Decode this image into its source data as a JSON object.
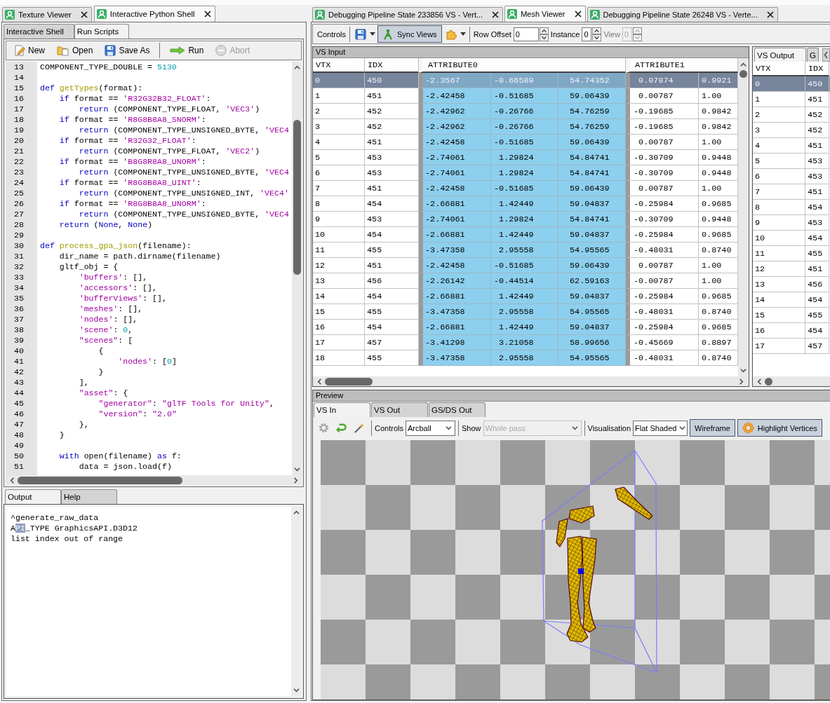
{
  "left_panel": {
    "tabs": [
      {
        "label": "Texture Viewer",
        "selected": false
      },
      {
        "label": "Interactive Python Shell",
        "selected": true
      }
    ],
    "script_tabs": [
      {
        "label": "Interactive Shell",
        "selected": false
      },
      {
        "label": "Run Scripts",
        "selected": true
      }
    ],
    "toolbar": [
      {
        "kind": "new",
        "label": "New",
        "disabled": false
      },
      {
        "kind": "open",
        "label": "Open",
        "disabled": false
      },
      {
        "kind": "save_as",
        "label": "Save As",
        "disabled": false
      },
      {
        "kind": "separator"
      },
      {
        "kind": "run",
        "label": "Run",
        "disabled": false
      },
      {
        "kind": "abort",
        "label": "Abort",
        "disabled": true
      }
    ],
    "editor": {
      "lines": [
        {
          "number": "13",
          "tokens": [
            {
              "kind": "plain",
              "text": "COMPONENT_TYPE_DOUBLE = "
            },
            {
              "kind": "number",
              "text": "5130"
            }
          ]
        },
        {
          "number": "14"
        },
        {
          "number": "15",
          "tokens": [
            {
              "kind": "keyword",
              "text": "def "
            },
            {
              "kind": "function",
              "text": "getTypes"
            },
            {
              "kind": "plain",
              "text": "(format):"
            }
          ]
        },
        {
          "number": "16",
          "tokens": [
            {
              "kind": "keyword",
              "text": "    if"
            },
            {
              "kind": "plain",
              "text": " format == "
            },
            {
              "kind": "string",
              "text": "'R32G32B32_FLOAT'"
            },
            {
              "kind": "plain",
              "text": ":"
            }
          ]
        },
        {
          "number": "17",
          "tokens": [
            {
              "kind": "keyword",
              "text": "        return"
            },
            {
              "kind": "plain",
              "text": " (COMPONENT_TYPE_FLOAT, "
            },
            {
              "kind": "string",
              "text": "'VEC3'"
            },
            {
              "kind": "plain",
              "text": ")"
            }
          ]
        },
        {
          "number": "18",
          "tokens": [
            {
              "kind": "keyword",
              "text": "    if"
            },
            {
              "kind": "plain",
              "text": " format == "
            },
            {
              "kind": "string",
              "text": "'R8G8B8A8_SNORM'"
            },
            {
              "kind": "plain",
              "text": ":"
            }
          ]
        },
        {
          "number": "19",
          "tokens": [
            {
              "kind": "keyword",
              "text": "        return"
            },
            {
              "kind": "plain",
              "text": " (COMPONENT_TYPE_UNSIGNED_BYTE, "
            },
            {
              "kind": "string",
              "text": "'VEC4"
            }
          ]
        },
        {
          "number": "20",
          "tokens": [
            {
              "kind": "keyword",
              "text": "    if"
            },
            {
              "kind": "plain",
              "text": " format == "
            },
            {
              "kind": "string",
              "text": "'R32G32_FLOAT'"
            },
            {
              "kind": "plain",
              "text": ":"
            }
          ]
        },
        {
          "number": "21",
          "tokens": [
            {
              "kind": "keyword",
              "text": "        return"
            },
            {
              "kind": "plain",
              "text": " (COMPONENT_TYPE_FLOAT, "
            },
            {
              "kind": "string",
              "text": "'VEC2'"
            },
            {
              "kind": "plain",
              "text": ")"
            }
          ]
        },
        {
          "number": "22",
          "tokens": [
            {
              "kind": "keyword",
              "text": "    if"
            },
            {
              "kind": "plain",
              "text": " format == "
            },
            {
              "kind": "string",
              "text": "'B8G8R8A8_UNORM'"
            },
            {
              "kind": "plain",
              "text": ":"
            }
          ]
        },
        {
          "number": "23",
          "tokens": [
            {
              "kind": "keyword",
              "text": "        return"
            },
            {
              "kind": "plain",
              "text": " (COMPONENT_TYPE_UNSIGNED_BYTE, "
            },
            {
              "kind": "string",
              "text": "'VEC4"
            }
          ]
        },
        {
          "number": "24",
          "tokens": [
            {
              "kind": "keyword",
              "text": "    if"
            },
            {
              "kind": "plain",
              "text": " format == "
            },
            {
              "kind": "string",
              "text": "'R8G8B8A8_UINT'"
            },
            {
              "kind": "plain",
              "text": ":"
            }
          ]
        },
        {
          "number": "25",
          "tokens": [
            {
              "kind": "keyword",
              "text": "        return"
            },
            {
              "kind": "plain",
              "text": " (COMPONENT_TYPE_UNSIGNED_INT, "
            },
            {
              "kind": "string",
              "text": "'VEC4'"
            }
          ]
        },
        {
          "number": "26",
          "tokens": [
            {
              "kind": "keyword",
              "text": "    if"
            },
            {
              "kind": "plain",
              "text": " format == "
            },
            {
              "kind": "string",
              "text": "'R8G8B8A8_UNORM'"
            },
            {
              "kind": "plain",
              "text": ":"
            }
          ]
        },
        {
          "number": "27",
          "tokens": [
            {
              "kind": "keyword",
              "text": "        return"
            },
            {
              "kind": "plain",
              "text": " (COMPONENT_TYPE_UNSIGNED_BYTE, "
            },
            {
              "kind": "string",
              "text": "'VEC4"
            }
          ]
        },
        {
          "number": "28",
          "tokens": [
            {
              "kind": "keyword",
              "text": "    return"
            },
            {
              "kind": "plain",
              "text": " ("
            },
            {
              "kind": "keyword",
              "text": "None"
            },
            {
              "kind": "plain",
              "text": ", "
            },
            {
              "kind": "keyword",
              "text": "None"
            },
            {
              "kind": "plain",
              "text": ")"
            }
          ]
        },
        {
          "number": "29"
        },
        {
          "number": "30",
          "tokens": [
            {
              "kind": "keyword",
              "text": "def "
            },
            {
              "kind": "function",
              "text": "process_gpa_json"
            },
            {
              "kind": "plain",
              "text": "(filename):"
            }
          ]
        },
        {
          "number": "31",
          "tokens": [
            {
              "kind": "plain",
              "text": "    dir_name = path.dirname(filename)"
            }
          ]
        },
        {
          "number": "32",
          "tokens": [
            {
              "kind": "plain",
              "text": "    gltf_obj = {"
            }
          ]
        },
        {
          "number": "33",
          "tokens": [
            {
              "kind": "string",
              "text": "        'buffers'"
            },
            {
              "kind": "plain",
              "text": ": [],"
            }
          ]
        },
        {
          "number": "34",
          "tokens": [
            {
              "kind": "string",
              "text": "        'accessors'"
            },
            {
              "kind": "plain",
              "text": ": [],"
            }
          ]
        },
        {
          "number": "35",
          "tokens": [
            {
              "kind": "string",
              "text": "        'bufferViews'"
            },
            {
              "kind": "plain",
              "text": ": [],"
            }
          ]
        },
        {
          "number": "36",
          "tokens": [
            {
              "kind": "string",
              "text": "        'meshes'"
            },
            {
              "kind": "plain",
              "text": ": [],"
            }
          ]
        },
        {
          "number": "37",
          "tokens": [
            {
              "kind": "string",
              "text": "        'nodes'"
            },
            {
              "kind": "plain",
              "text": ": [],"
            }
          ]
        },
        {
          "number": "38",
          "tokens": [
            {
              "kind": "string",
              "text": "        'scene'"
            },
            {
              "kind": "plain",
              "text": ": "
            },
            {
              "kind": "number",
              "text": "0"
            },
            {
              "kind": "plain",
              "text": ","
            }
          ]
        },
        {
          "number": "39",
          "tokens": [
            {
              "kind": "string",
              "text": "        \"scenes\""
            },
            {
              "kind": "plain",
              "text": ": ["
            }
          ]
        },
        {
          "number": "40",
          "tokens": [
            {
              "kind": "plain",
              "text": "            {"
            }
          ]
        },
        {
          "number": "41",
          "tokens": [
            {
              "kind": "string",
              "text": "                'nodes'"
            },
            {
              "kind": "plain",
              "text": ": ["
            },
            {
              "kind": "number",
              "text": "0"
            },
            {
              "kind": "plain",
              "text": "]"
            }
          ]
        },
        {
          "number": "42",
          "tokens": [
            {
              "kind": "plain",
              "text": "            }"
            }
          ]
        },
        {
          "number": "43",
          "tokens": [
            {
              "kind": "plain",
              "text": "        ],"
            }
          ]
        },
        {
          "number": "44",
          "tokens": [
            {
              "kind": "string",
              "text": "        \"asset\""
            },
            {
              "kind": "plain",
              "text": ": {"
            }
          ]
        },
        {
          "number": "45",
          "tokens": [
            {
              "kind": "string",
              "text": "            \"generator\""
            },
            {
              "kind": "plain",
              "text": ": "
            },
            {
              "kind": "string",
              "text": "\"glTF Tools for Unity\""
            },
            {
              "kind": "plain",
              "text": ","
            }
          ]
        },
        {
          "number": "46",
          "tokens": [
            {
              "kind": "string",
              "text": "            \"version\""
            },
            {
              "kind": "plain",
              "text": ": "
            },
            {
              "kind": "string",
              "text": "\"2.0\""
            }
          ]
        },
        {
          "number": "47",
          "tokens": [
            {
              "kind": "plain",
              "text": "        },"
            }
          ]
        },
        {
          "number": "48",
          "tokens": [
            {
              "kind": "plain",
              "text": "    }"
            }
          ]
        },
        {
          "number": "49"
        },
        {
          "number": "50",
          "tokens": [
            {
              "kind": "keyword",
              "text": "    with"
            },
            {
              "kind": "plain",
              "text": " open(filename) "
            },
            {
              "kind": "keyword",
              "text": "as"
            },
            {
              "kind": "plain",
              "text": " f:"
            }
          ]
        },
        {
          "number": "51",
          "tokens": [
            {
              "kind": "plain",
              "text": "        data = json.load(f)"
            }
          ]
        }
      ]
    },
    "output_tabs": [
      {
        "label": "Output",
        "selected": true
      },
      {
        "label": "Help",
        "selected": false
      }
    ],
    "output": {
      "lines": [
        {
          "segments": [
            {
              "text": "^generate_raw_data",
              "selected": false
            }
          ]
        },
        {
          "segments": [
            {
              "text": "A",
              "selected": false
            },
            {
              "text": "PI",
              "selected": true
            },
            {
              "text": "_TYPE GraphicsAPI.D3D12",
              "selected": false
            }
          ]
        },
        {
          "segments": [
            {
              "text": "list index out of range",
              "selected": false
            }
          ]
        }
      ]
    }
  },
  "right_panel": {
    "tabs": [
      {
        "label": "Debugging Pipeline State 233856 VS - Vert...",
        "selected": false
      },
      {
        "label": "Mesh Viewer",
        "selected": true
      },
      {
        "label": "Debugging Pipeline State 26248 VS - Verte...",
        "selected": false
      }
    ],
    "toolbar": {
      "label": "Controls",
      "sync_views": {
        "label": "Sync Views",
        "on": true
      },
      "row_offset": {
        "label": "Row Offset",
        "value": "0",
        "disabled": false
      },
      "instance": {
        "label": "Instance",
        "value": "0",
        "disabled": false
      },
      "view": {
        "label": "View",
        "value": "0",
        "disabled": true
      }
    },
    "vs_input": {
      "title": "VS Input",
      "columns": [
        "VTX",
        "IDX",
        "ATTRIBUTE0",
        "ATTRIBUTE1"
      ],
      "rows": [
        {
          "selected": true,
          "cells": [
            "0",
            "450",
            [
              "-2.3567",
              "-0.66589",
              "54.74352"
            ],
            [
              "0.07874",
              "0.9921"
            ]
          ]
        },
        {
          "selected": false,
          "cells": [
            "1",
            "451",
            [
              "-2.42458",
              "-0.51685",
              "59.06439"
            ],
            [
              "0.00787",
              "1.00"
            ]
          ]
        },
        {
          "selected": false,
          "cells": [
            "2",
            "452",
            [
              "-2.42962",
              "-0.26766",
              "54.76259"
            ],
            [
              "-0.19685",
              "0.9842"
            ]
          ]
        },
        {
          "selected": false,
          "cells": [
            "3",
            "452",
            [
              "-2.42962",
              "-0.26766",
              "54.76259"
            ],
            [
              "-0.19685",
              "0.9842"
            ]
          ]
        },
        {
          "selected": false,
          "cells": [
            "4",
            "451",
            [
              "-2.42458",
              "-0.51685",
              "59.06439"
            ],
            [
              "0.00787",
              "1.00"
            ]
          ]
        },
        {
          "selected": false,
          "cells": [
            "5",
            "453",
            [
              "-2.74061",
              "1.29824",
              "54.84741"
            ],
            [
              "-0.30709",
              "0.9448"
            ]
          ]
        },
        {
          "selected": false,
          "cells": [
            "6",
            "453",
            [
              "-2.74061",
              "1.29824",
              "54.84741"
            ],
            [
              "-0.30709",
              "0.9448"
            ]
          ]
        },
        {
          "selected": false,
          "cells": [
            "7",
            "451",
            [
              "-2.42458",
              "-0.51685",
              "59.06439"
            ],
            [
              "0.00787",
              "1.00"
            ]
          ]
        },
        {
          "selected": false,
          "cells": [
            "8",
            "454",
            [
              "-2.66881",
              "1.42449",
              "59.04837"
            ],
            [
              "-0.25984",
              "0.9685"
            ]
          ]
        },
        {
          "selected": false,
          "cells": [
            "9",
            "453",
            [
              "-2.74061",
              "1.29824",
              "54.84741"
            ],
            [
              "-0.30709",
              "0.9448"
            ]
          ]
        },
        {
          "selected": false,
          "cells": [
            "10",
            "454",
            [
              "-2.66881",
              "1.42449",
              "59.04837"
            ],
            [
              "-0.25984",
              "0.9685"
            ]
          ]
        },
        {
          "selected": false,
          "cells": [
            "11",
            "455",
            [
              "-3.47358",
              "2.95558",
              "54.95565"
            ],
            [
              "-0.48031",
              "0.8740"
            ]
          ]
        },
        {
          "selected": false,
          "cells": [
            "12",
            "451",
            [
              "-2.42458",
              "-0.51685",
              "59.06439"
            ],
            [
              "0.00787",
              "1.00"
            ]
          ]
        },
        {
          "selected": false,
          "cells": [
            "13",
            "456",
            [
              "-2.26142",
              "-0.44514",
              "62.59163"
            ],
            [
              "-0.00787",
              "1.00"
            ]
          ]
        },
        {
          "selected": false,
          "cells": [
            "14",
            "454",
            [
              "-2.66881",
              "1.42449",
              "59.04837"
            ],
            [
              "-0.25984",
              "0.9685"
            ]
          ]
        },
        {
          "selected": false,
          "cells": [
            "15",
            "455",
            [
              "-3.47358",
              "2.95558",
              "54.95565"
            ],
            [
              "-0.48031",
              "0.8740"
            ]
          ]
        },
        {
          "selected": false,
          "cells": [
            "16",
            "454",
            [
              "-2.66881",
              "1.42449",
              "59.04837"
            ],
            [
              "-0.25984",
              "0.9685"
            ]
          ]
        },
        {
          "selected": false,
          "cells": [
            "17",
            "457",
            [
              "-3.41298",
              "3.21058",
              "58.99656"
            ],
            [
              "-0.45669",
              "0.8897"
            ]
          ]
        },
        {
          "selected": false,
          "cells": [
            "18",
            "455",
            [
              "-3.47358",
              "2.95558",
              "54.95565"
            ],
            [
              "-0.48031",
              "0.8740"
            ]
          ]
        }
      ]
    },
    "vs_output": {
      "tabs": [
        {
          "label": "VS Output",
          "selected": true
        },
        {
          "label": "G",
          "selected": false
        }
      ],
      "columns": [
        "VTX",
        "IDX"
      ],
      "rows": [
        {
          "selected": true,
          "cells": [
            "0",
            "450"
          ]
        },
        {
          "selected": false,
          "cells": [
            "1",
            "451"
          ]
        },
        {
          "selected": false,
          "cells": [
            "2",
            "452"
          ]
        },
        {
          "selected": false,
          "cells": [
            "3",
            "452"
          ]
        },
        {
          "selected": false,
          "cells": [
            "4",
            "451"
          ]
        },
        {
          "selected": false,
          "cells": [
            "5",
            "453"
          ]
        },
        {
          "selected": false,
          "cells": [
            "6",
            "453"
          ]
        },
        {
          "selected": false,
          "cells": [
            "7",
            "451"
          ]
        },
        {
          "selected": false,
          "cells": [
            "8",
            "454"
          ]
        },
        {
          "selected": false,
          "cells": [
            "9",
            "453"
          ]
        },
        {
          "selected": false,
          "cells": [
            "10",
            "454"
          ]
        },
        {
          "selected": false,
          "cells": [
            "11",
            "455"
          ]
        },
        {
          "selected": false,
          "cells": [
            "12",
            "451"
          ]
        },
        {
          "selected": false,
          "cells": [
            "13",
            "456"
          ]
        },
        {
          "selected": false,
          "cells": [
            "14",
            "454"
          ]
        },
        {
          "selected": false,
          "cells": [
            "15",
            "455"
          ]
        },
        {
          "selected": false,
          "cells": [
            "16",
            "454"
          ]
        },
        {
          "selected": false,
          "cells": [
            "17",
            "457"
          ]
        }
      ]
    },
    "preview": {
      "title": "Preview",
      "tabs": [
        {
          "label": "VS In",
          "selected": true
        },
        {
          "label": "VS Out",
          "selected": false
        },
        {
          "label": "GS/DS Out",
          "selected": false
        }
      ],
      "toolbar": {
        "controls": {
          "label": "Controls",
          "value": "Arcball",
          "disabled": false
        },
        "show": {
          "label": "Show",
          "value": "Whole pass",
          "disabled": true
        },
        "visualisation": {
          "label": "Visualisation",
          "value": "Flat Shaded",
          "disabled": false
        },
        "wireframe": {
          "label": "Wireframe",
          "on": true
        },
        "highlight_vertices": {
          "label": "Highlight Vertices",
          "on": true
        }
      }
    }
  }
}
